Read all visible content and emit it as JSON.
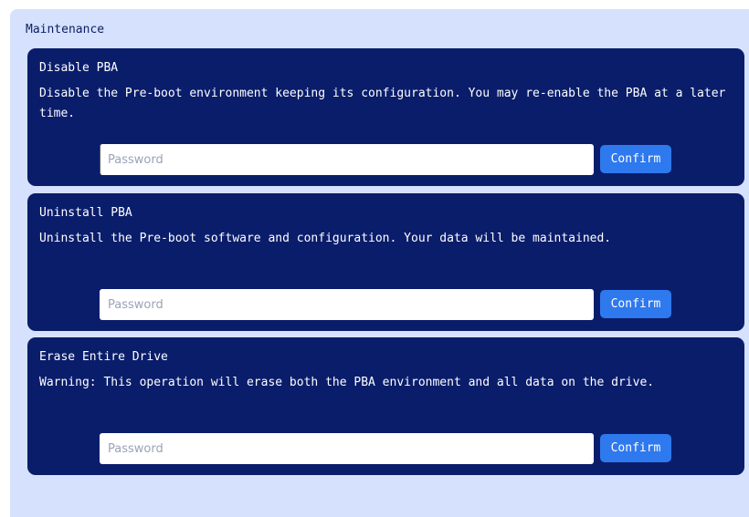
{
  "section": {
    "title": "Maintenance"
  },
  "cards": [
    {
      "title": "Disable PBA",
      "description": "Disable the Pre-boot environment keeping its configuration. You may re-enable the PBA at a later time.",
      "password_placeholder": "Password",
      "password_value": "",
      "confirm_label": "Confirm"
    },
    {
      "title": "Uninstall PBA",
      "description": "Uninstall the Pre-boot software and configuration. Your data will be maintained.",
      "password_placeholder": "Password",
      "password_value": "",
      "confirm_label": "Confirm"
    },
    {
      "title": "Erase Entire Drive",
      "description": "Warning: This operation will erase both the PBA environment and all data on the drive.",
      "password_placeholder": "Password",
      "password_value": "",
      "confirm_label": "Confirm"
    }
  ],
  "colors": {
    "panel_background": "#d5e1fd",
    "card_background": "#0a1d6b",
    "button_accent": "#2f79ee"
  }
}
